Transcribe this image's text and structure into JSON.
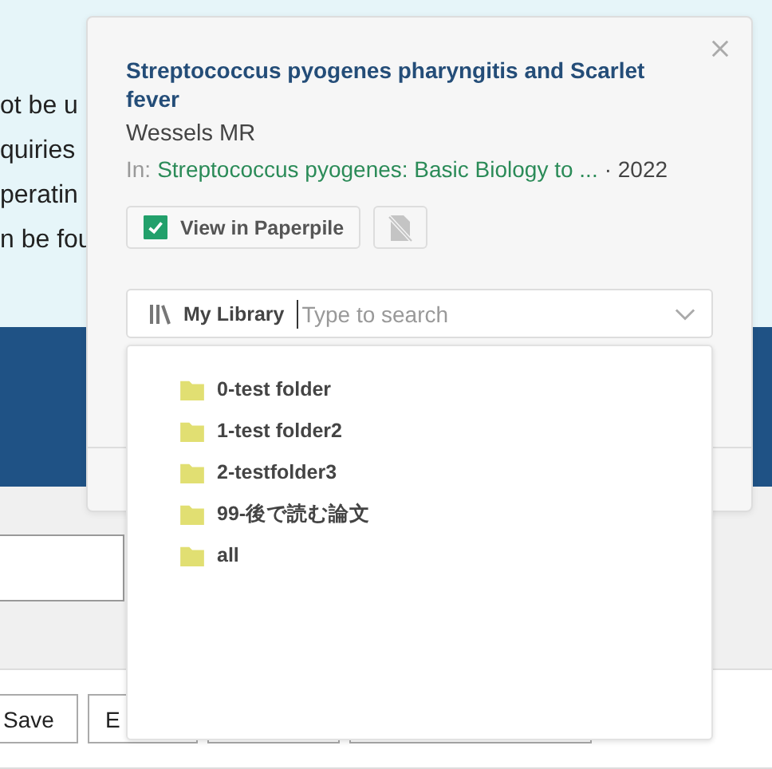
{
  "page": {
    "text_lines": [
      "ot be u",
      "quiries",
      "peratin",
      "n be fou"
    ],
    "buttons": [
      "Save",
      "E"
    ]
  },
  "popup": {
    "title": "Streptococcus pyogenes pharyngitis and Scarlet fever",
    "author": "Wessels MR",
    "source_label": "In:",
    "source": "Streptococcus pyogenes: Basic Biology to ...",
    "year": "· 2022",
    "view_button": {
      "label": "View in Paperpile",
      "checked": true
    },
    "pdf_button": {
      "disabled": true
    },
    "library": {
      "label": "My Library",
      "placeholder": "Type to search"
    }
  },
  "folders": [
    {
      "name": "0-test folder"
    },
    {
      "name": "1-test folder2"
    },
    {
      "name": "2-testfolder3"
    },
    {
      "name": "99-後で読む論文"
    },
    {
      "name": "all"
    }
  ]
}
